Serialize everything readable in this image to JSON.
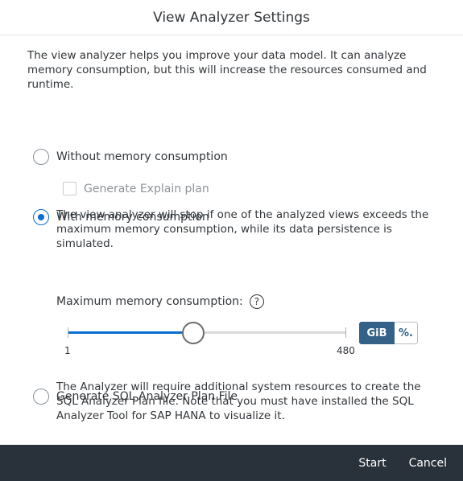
{
  "dialog": {
    "title": "View Analyzer Settings",
    "intro": "The view analyzer helps you improve your data model. It can analyze memory consumption, but this will increase the resources consumed and runtime."
  },
  "options": {
    "without_memory": {
      "label": "Without memory consumption",
      "selected": false
    },
    "explain_plan": {
      "label": "Generate Explain plan",
      "checked": false,
      "disabled": true
    },
    "with_memory": {
      "label": "With memory consumption",
      "selected": true,
      "description": "The view analyzer will stop if one of the analyzed views exceeds the maximum memory consumption, while its data persistence is simulated."
    },
    "sql_plan": {
      "label": "Generate SQL Analyzer Plan File",
      "selected": false,
      "description": "The Analyzer will require additional system resources to create the SQL Analyzer Plan file. Note that you must have installed the SQL Analyzer Tool for SAP HANA to visualize it."
    }
  },
  "memory": {
    "label": "Maximum memory consumption:",
    "help_icon": "question-circle-icon",
    "min_label": "1",
    "max_label": "480",
    "value_fraction": 0.45,
    "units": {
      "primary": "GiB",
      "secondary": "%."
    },
    "active_unit": "GiB"
  },
  "footer": {
    "start_label": "Start",
    "cancel_label": "Cancel"
  },
  "colors": {
    "accent": "#0a6ed1",
    "footer_bg": "#29313a",
    "toggle_active": "#346187"
  }
}
